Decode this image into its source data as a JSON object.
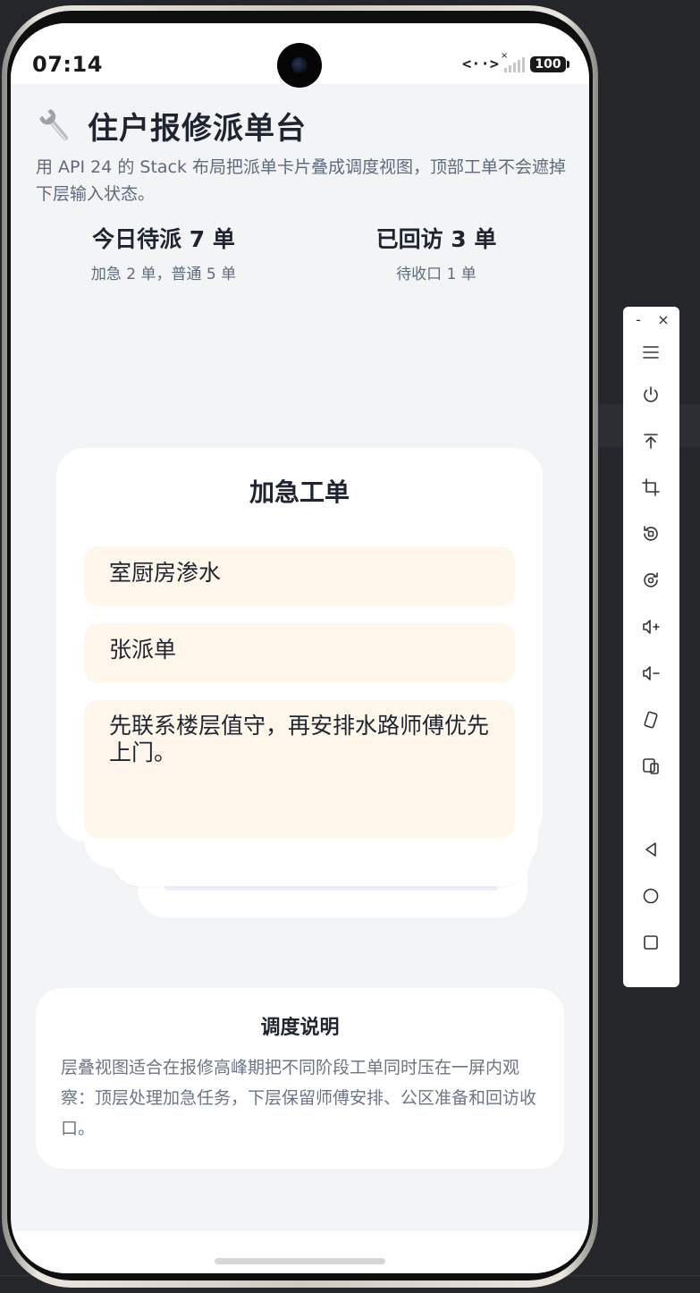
{
  "status_bar": {
    "time": "07:14",
    "nfc": "<··>",
    "battery": "100"
  },
  "header": {
    "title": "住户报修派单台",
    "subtitle": "用 API 24 的 Stack 布局把派单卡片叠成调度视图，顶部工单不会遮掉下层输入状态。"
  },
  "stats": {
    "pending": {
      "value": "今日待派 7 单",
      "detail": "加急 2 单，普通 5 单"
    },
    "visited": {
      "value": "已回访 3 单",
      "detail": "待收口 1 单"
    }
  },
  "urgent_card": {
    "title": "加急工单",
    "issue_value": "室厨房渗水",
    "technician_value": "张派单",
    "note_value": "先联系楼层值守，再安排水路师傅优先上门。"
  },
  "info_card": {
    "title": "调度说明",
    "body": "层叠视图适合在报修高峰期把不同阶段工单同时压在一屏内观察：顶层处理加急任务，下层保留师傅安排、公区准备和回访收口。"
  },
  "toolbar": {
    "minimize_label": "-",
    "close_label": "×"
  },
  "colors": {
    "page_background": "#f3f4f6",
    "card_background": "#ffffff",
    "field_background": "#fff6ec",
    "title_text": "#1f2530",
    "muted_text": "#5f6b7c"
  }
}
